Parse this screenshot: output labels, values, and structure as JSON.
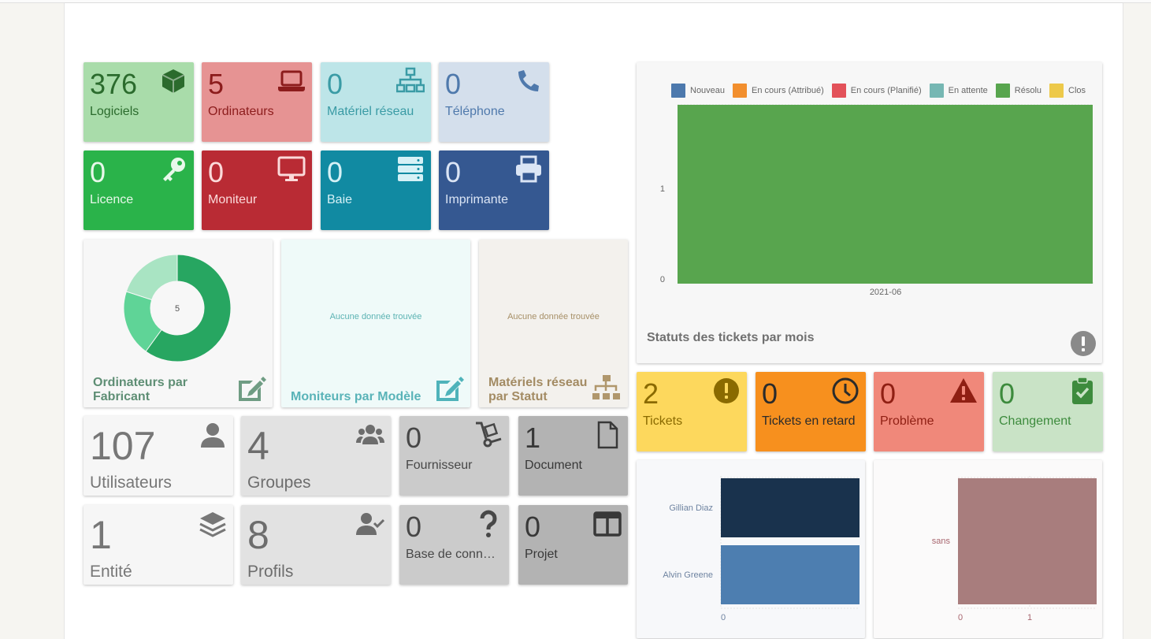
{
  "assets": [
    {
      "count": "376",
      "label": "Logiciels",
      "icon": "box-icon",
      "bg": "#a9dcaa",
      "fg": "#2b6b2d"
    },
    {
      "count": "5",
      "label": "Ordinateurs",
      "icon": "laptop-icon",
      "bg": "#e69393",
      "fg": "#8c1c1c"
    },
    {
      "count": "0",
      "label": "Matériel réseau",
      "icon": "network-icon",
      "bg": "#bde5e8",
      "fg": "#3a9ba5"
    },
    {
      "count": "0",
      "label": "Téléphone",
      "icon": "phone-icon",
      "bg": "#d4dfec",
      "fg": "#4f79ac"
    },
    {
      "count": "0",
      "label": "Licence",
      "icon": "key-icon",
      "bg": "#2ab34a",
      "fg": "#e8f8ea"
    },
    {
      "count": "0",
      "label": "Moniteur",
      "icon": "monitor-icon",
      "bg": "#b92b34",
      "fg": "#fbdada"
    },
    {
      "count": "0",
      "label": "Baie",
      "icon": "server-icon",
      "bg": "#118aa2",
      "fg": "#d6f1f6"
    },
    {
      "count": "0",
      "label": "Imprimante",
      "icon": "printer-icon",
      "bg": "#355891",
      "fg": "#dbe5f5"
    }
  ],
  "widgets": {
    "computers": {
      "title": "Ordinateurs par Fabricant",
      "center": "5",
      "slices": [
        {
          "value": 3,
          "color": "#27a661"
        },
        {
          "value": 1,
          "color": "#5fd497"
        },
        {
          "value": 1,
          "color": "#a9e4c3"
        }
      ]
    },
    "monitors": {
      "title": "Moniteurs par Modèle",
      "nodata": "Aucune donnée trouvée"
    },
    "network": {
      "title": "Matériels réseau par Statut",
      "nodata": "Aucune donnée trouvée"
    }
  },
  "admin": [
    {
      "count": "107",
      "label": "Utilisateurs",
      "icon": "user-icon",
      "bg": "#f6f6f6",
      "fg": "#777777"
    },
    {
      "count": "4",
      "label": "Groupes",
      "icon": "users-icon",
      "bg": "#e2e2e2",
      "fg": "#6d6d6d"
    },
    {
      "count": "0",
      "label": "Fournisseur",
      "icon": "dolly-icon",
      "bg": "#cbcbcb",
      "fg": "#474747"
    },
    {
      "count": "1",
      "label": "Document",
      "icon": "document-icon",
      "bg": "#b3b3b3",
      "fg": "#383838"
    },
    {
      "count": "1",
      "label": "Entité",
      "icon": "layers-icon",
      "bg": "#f6f6f6",
      "fg": "#777777"
    },
    {
      "count": "8",
      "label": "Profils",
      "icon": "user-check-icon",
      "bg": "#e2e2e2",
      "fg": "#6d6d6d"
    },
    {
      "count": "0",
      "label": "Base de conn…",
      "icon": "question-icon",
      "bg": "#cbcbcb",
      "fg": "#474747"
    },
    {
      "count": "0",
      "label": "Projet",
      "icon": "columns-icon",
      "bg": "#b3b3b3",
      "fg": "#383838"
    }
  ],
  "tickets_chart": {
    "title": "Statuts des tickets par mois",
    "legend": [
      {
        "name": "Nouveau",
        "color": "#4d79ad"
      },
      {
        "name": "En cours (Attribué)",
        "color": "#f28f2e"
      },
      {
        "name": "En cours (Planifié)",
        "color": "#e3525a"
      },
      {
        "name": "En attente",
        "color": "#76b7b3"
      },
      {
        "name": "Résolu",
        "color": "#58a54e"
      },
      {
        "name": "Clos",
        "color": "#edc94a"
      }
    ]
  },
  "ticket_stats": [
    {
      "count": "2",
      "label": "Tickets",
      "icon": "exclamation-circle-icon",
      "bg": "#fdd85d",
      "fg": "#8a6a00"
    },
    {
      "count": "0",
      "label": "Tickets en retard",
      "icon": "clock-icon",
      "bg": "#f7901e",
      "fg": "#2b2b2b"
    },
    {
      "count": "0",
      "label": "Problème",
      "icon": "warning-icon",
      "bg": "#f0887a",
      "fg": "#8f1f13"
    },
    {
      "count": "0",
      "label": "Changement",
      "icon": "clipboard-check-icon",
      "bg": "#c9e3c6",
      "fg": "#3d8b3d"
    }
  ],
  "chart_data": [
    {
      "type": "bar",
      "title": "Statuts des tickets par mois",
      "categories": [
        "2021-06"
      ],
      "series": [
        {
          "name": "Résolu",
          "values": [
            1
          ]
        }
      ],
      "ylim": [
        0,
        1
      ],
      "yticks": [
        "0",
        "1"
      ]
    },
    {
      "type": "bar",
      "orientation": "horizontal",
      "categories": [
        "Gillian Diaz",
        "Alvin Greene"
      ],
      "values": [
        1,
        1
      ],
      "colors": [
        "#19324d",
        "#4d7eb0"
      ],
      "xticks": [
        "0"
      ]
    },
    {
      "type": "bar",
      "orientation": "horizontal",
      "categories": [
        "sans"
      ],
      "values": [
        1
      ],
      "colors": [
        "#a87d7d"
      ],
      "xticks": [
        "0",
        "1"
      ]
    }
  ]
}
